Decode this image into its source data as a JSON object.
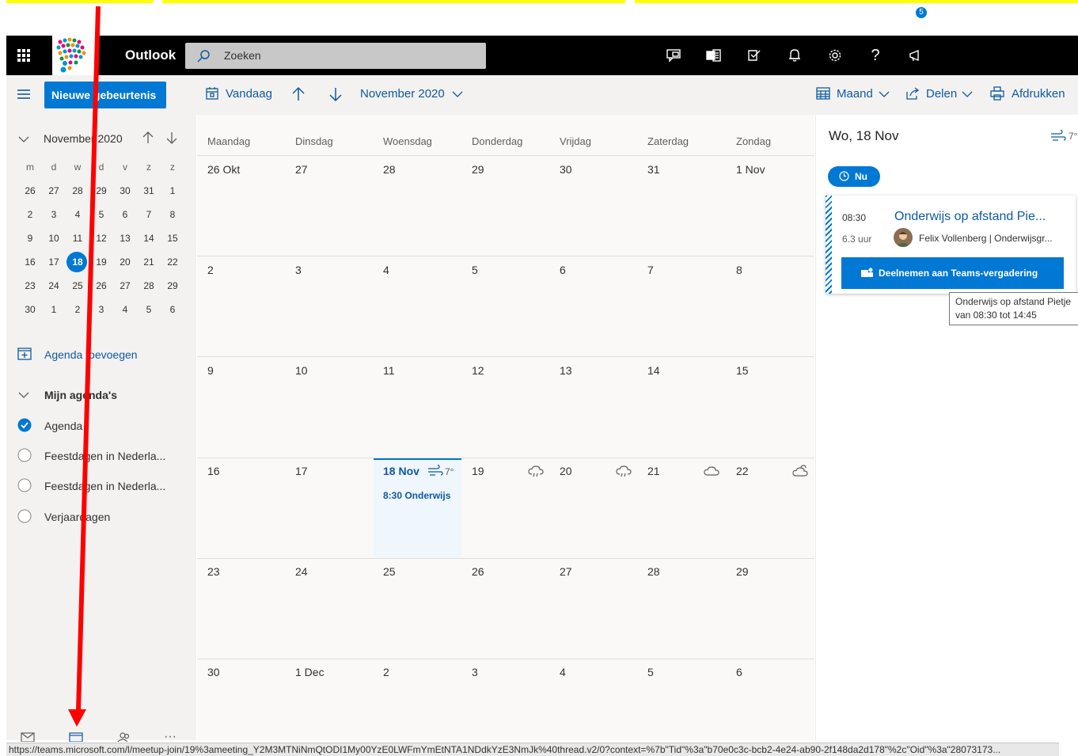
{
  "app": {
    "name": "Outlook"
  },
  "search": {
    "placeholder": "Zoeken"
  },
  "header": {
    "notification_count": "5"
  },
  "toolbar": {
    "new_event": "Nieuwe gebeurtenis",
    "today": "Vandaag",
    "month_label": "November 2020",
    "view": "Maand",
    "share": "Delen",
    "print": "Afdrukken"
  },
  "mini_calendar": {
    "title": "November 2020",
    "weekdays": [
      "m",
      "d",
      "w",
      "d",
      "v",
      "z",
      "z"
    ],
    "weeks": [
      [
        "26",
        "27",
        "28",
        "29",
        "30",
        "31",
        "1"
      ],
      [
        "2",
        "3",
        "4",
        "5",
        "6",
        "7",
        "8"
      ],
      [
        "9",
        "10",
        "11",
        "12",
        "13",
        "14",
        "15"
      ],
      [
        "16",
        "17",
        "18",
        "19",
        "20",
        "21",
        "22"
      ],
      [
        "23",
        "24",
        "25",
        "26",
        "27",
        "28",
        "29"
      ],
      [
        "30",
        "1",
        "2",
        "3",
        "4",
        "5",
        "6"
      ]
    ],
    "selected": "18"
  },
  "left_pane": {
    "add_calendar": "Agenda toevoegen",
    "my_calendars": "Mijn agenda's",
    "calendars": [
      {
        "label": "Agenda",
        "checked": true
      },
      {
        "label": "Feestdagen in Nederla...",
        "checked": false
      },
      {
        "label": "Feestdagen in Nederla...",
        "checked": false
      },
      {
        "label": "Verjaardagen",
        "checked": false
      }
    ]
  },
  "month_grid": {
    "weekdays": [
      "Maandag",
      "Dinsdag",
      "Woensdag",
      "Donderdag",
      "Vrijdag",
      "Zaterdag",
      "Zondag"
    ],
    "weeks": [
      [
        "26 Okt",
        "27",
        "28",
        "29",
        "30",
        "31",
        "1 Nov"
      ],
      [
        "2",
        "3",
        "4",
        "5",
        "6",
        "7",
        "8"
      ],
      [
        "9",
        "10",
        "11",
        "12",
        "13",
        "14",
        "15"
      ],
      [
        "16",
        "17",
        "18 Nov",
        "19",
        "20",
        "21",
        "22"
      ],
      [
        "23",
        "24",
        "25",
        "26",
        "27",
        "28",
        "29"
      ],
      [
        "30",
        "1 Dec",
        "2",
        "3",
        "4",
        "5",
        "6"
      ]
    ],
    "today_temp": "7°",
    "today_event": "8:30 Onderwijs"
  },
  "agenda_pane": {
    "date": "Wo, 18 Nov",
    "temp": "7°",
    "now_label": "Nu",
    "event": {
      "time": "08:30",
      "duration": "6.3 uur",
      "title": "Onderwijs op afstand Pie...",
      "organizer": "Felix Vollenberg | Onderwijsgr...",
      "join_label": "Deelnemen aan Teams-vergadering"
    },
    "tooltip_line1": "Onderwijs op afstand Pietje",
    "tooltip_line2": "van 08:30 tot 14:45"
  },
  "status_url": "https://teams.microsoft.com/l/meetup-join/19%3ameeting_Y2M3MTNiNmQtODI1My00YzE0LWFmYmEtNTA1NDdkYzE3NmJk%40thread.v2/0?context=%7b\"Tid\"%3a\"b70e0c3c-bcb2-4e24-ab90-2f148da2d178\"%2c\"Oid\"%3a\"28073173...",
  "colors": {
    "brand": "#0078d4",
    "header": "#000000",
    "arrow": "#ff0000",
    "highlight": "#ffff00"
  }
}
